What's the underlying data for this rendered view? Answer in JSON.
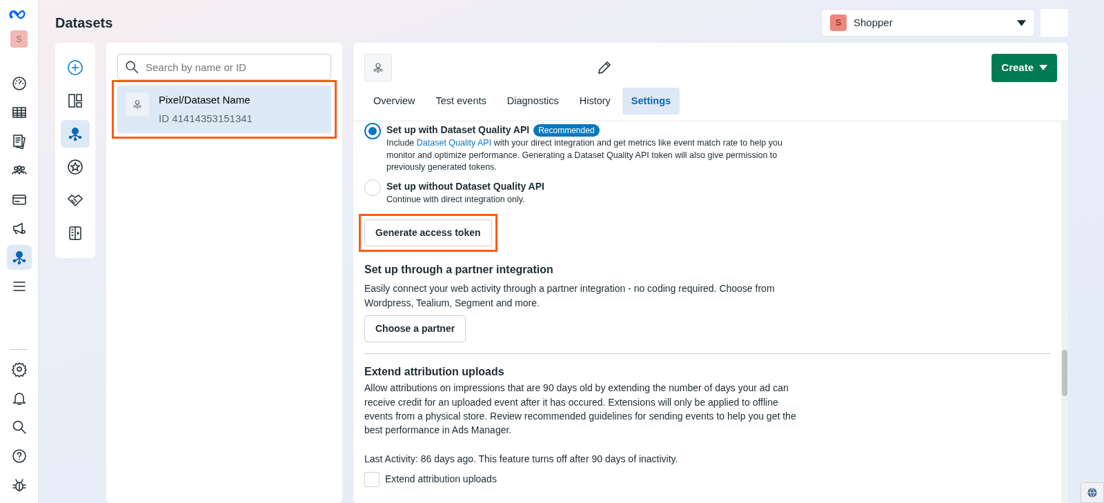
{
  "page_title": "Datasets",
  "rail": {
    "avatar": "S",
    "items": [
      {
        "kind": "gauge",
        "selected": false
      },
      {
        "kind": "table",
        "selected": false
      },
      {
        "kind": "pages",
        "selected": false
      },
      {
        "kind": "people",
        "selected": false
      },
      {
        "kind": "card",
        "selected": false
      },
      {
        "kind": "megaphone",
        "selected": false
      },
      {
        "kind": "dataset",
        "selected": true
      },
      {
        "kind": "menu",
        "selected": false
      }
    ],
    "bottom_items": [
      {
        "kind": "gear"
      },
      {
        "kind": "bell"
      },
      {
        "kind": "search"
      },
      {
        "kind": "help"
      },
      {
        "kind": "bug"
      }
    ]
  },
  "subnav": {
    "items": [
      {
        "kind": "plus",
        "selected": false
      },
      {
        "kind": "layout",
        "selected": false
      },
      {
        "kind": "dataset",
        "selected": true
      },
      {
        "kind": "star",
        "selected": false
      },
      {
        "kind": "handshake",
        "selected": false
      },
      {
        "kind": "panel",
        "selected": false
      }
    ]
  },
  "account": {
    "avatar": "S",
    "name": "Shopper"
  },
  "dataset_list": {
    "search": {
      "placeholder": "Search by name or ID"
    },
    "items": [
      {
        "name": "Pixel/Dataset Name",
        "id": "ID 41414353151341",
        "selected": true,
        "highlighted": true
      }
    ]
  },
  "detail": {
    "create_button": "Create",
    "tabs": [
      {
        "label": "Overview",
        "selected": false
      },
      {
        "label": "Test events",
        "selected": false
      },
      {
        "label": "Diagnostics",
        "selected": false
      },
      {
        "label": "History",
        "selected": false
      },
      {
        "label": "Settings",
        "selected": true
      }
    ],
    "options": [
      {
        "label": "Set up with Dataset Quality API",
        "badge": "Recommended",
        "selected": true,
        "description_before": "Include",
        "link": "Dataset Quality API",
        "description_after": "with your direct integration and get metrics like event match rate to help you monitor and optimize performance. Generating a Dataset Quality API token will also give permission to previously generated tokens."
      },
      {
        "label": "Set up without Dataset Quality API",
        "selected": false,
        "description_before": "Continue with direct integration only."
      }
    ],
    "generate_button": {
      "label": "Generate access token",
      "highlighted": true
    },
    "partner": {
      "title": "Set up through a partner integration",
      "text": "Easily connect your web activity through a partner integration - no coding required. Choose from Wordpress, Tealium, Segment and more.",
      "button": "Choose a partner"
    },
    "attribution": {
      "title": "Extend attribution uploads",
      "text": "Allow attributions on impressions that are 90 days old by extending the number of days your ad can receive credit for an uploaded event after it has occured. Extensions will only be applied to offline events from a physical store. Review recommended guidelines for sending events to help you get the best performance in Ads Manager.",
      "activity": "Last Activity: 86 days ago. This feature turns off after 90 days of inactivity.",
      "checkbox": {
        "label": "Extend attribution uploads",
        "checked": false
      }
    }
  }
}
